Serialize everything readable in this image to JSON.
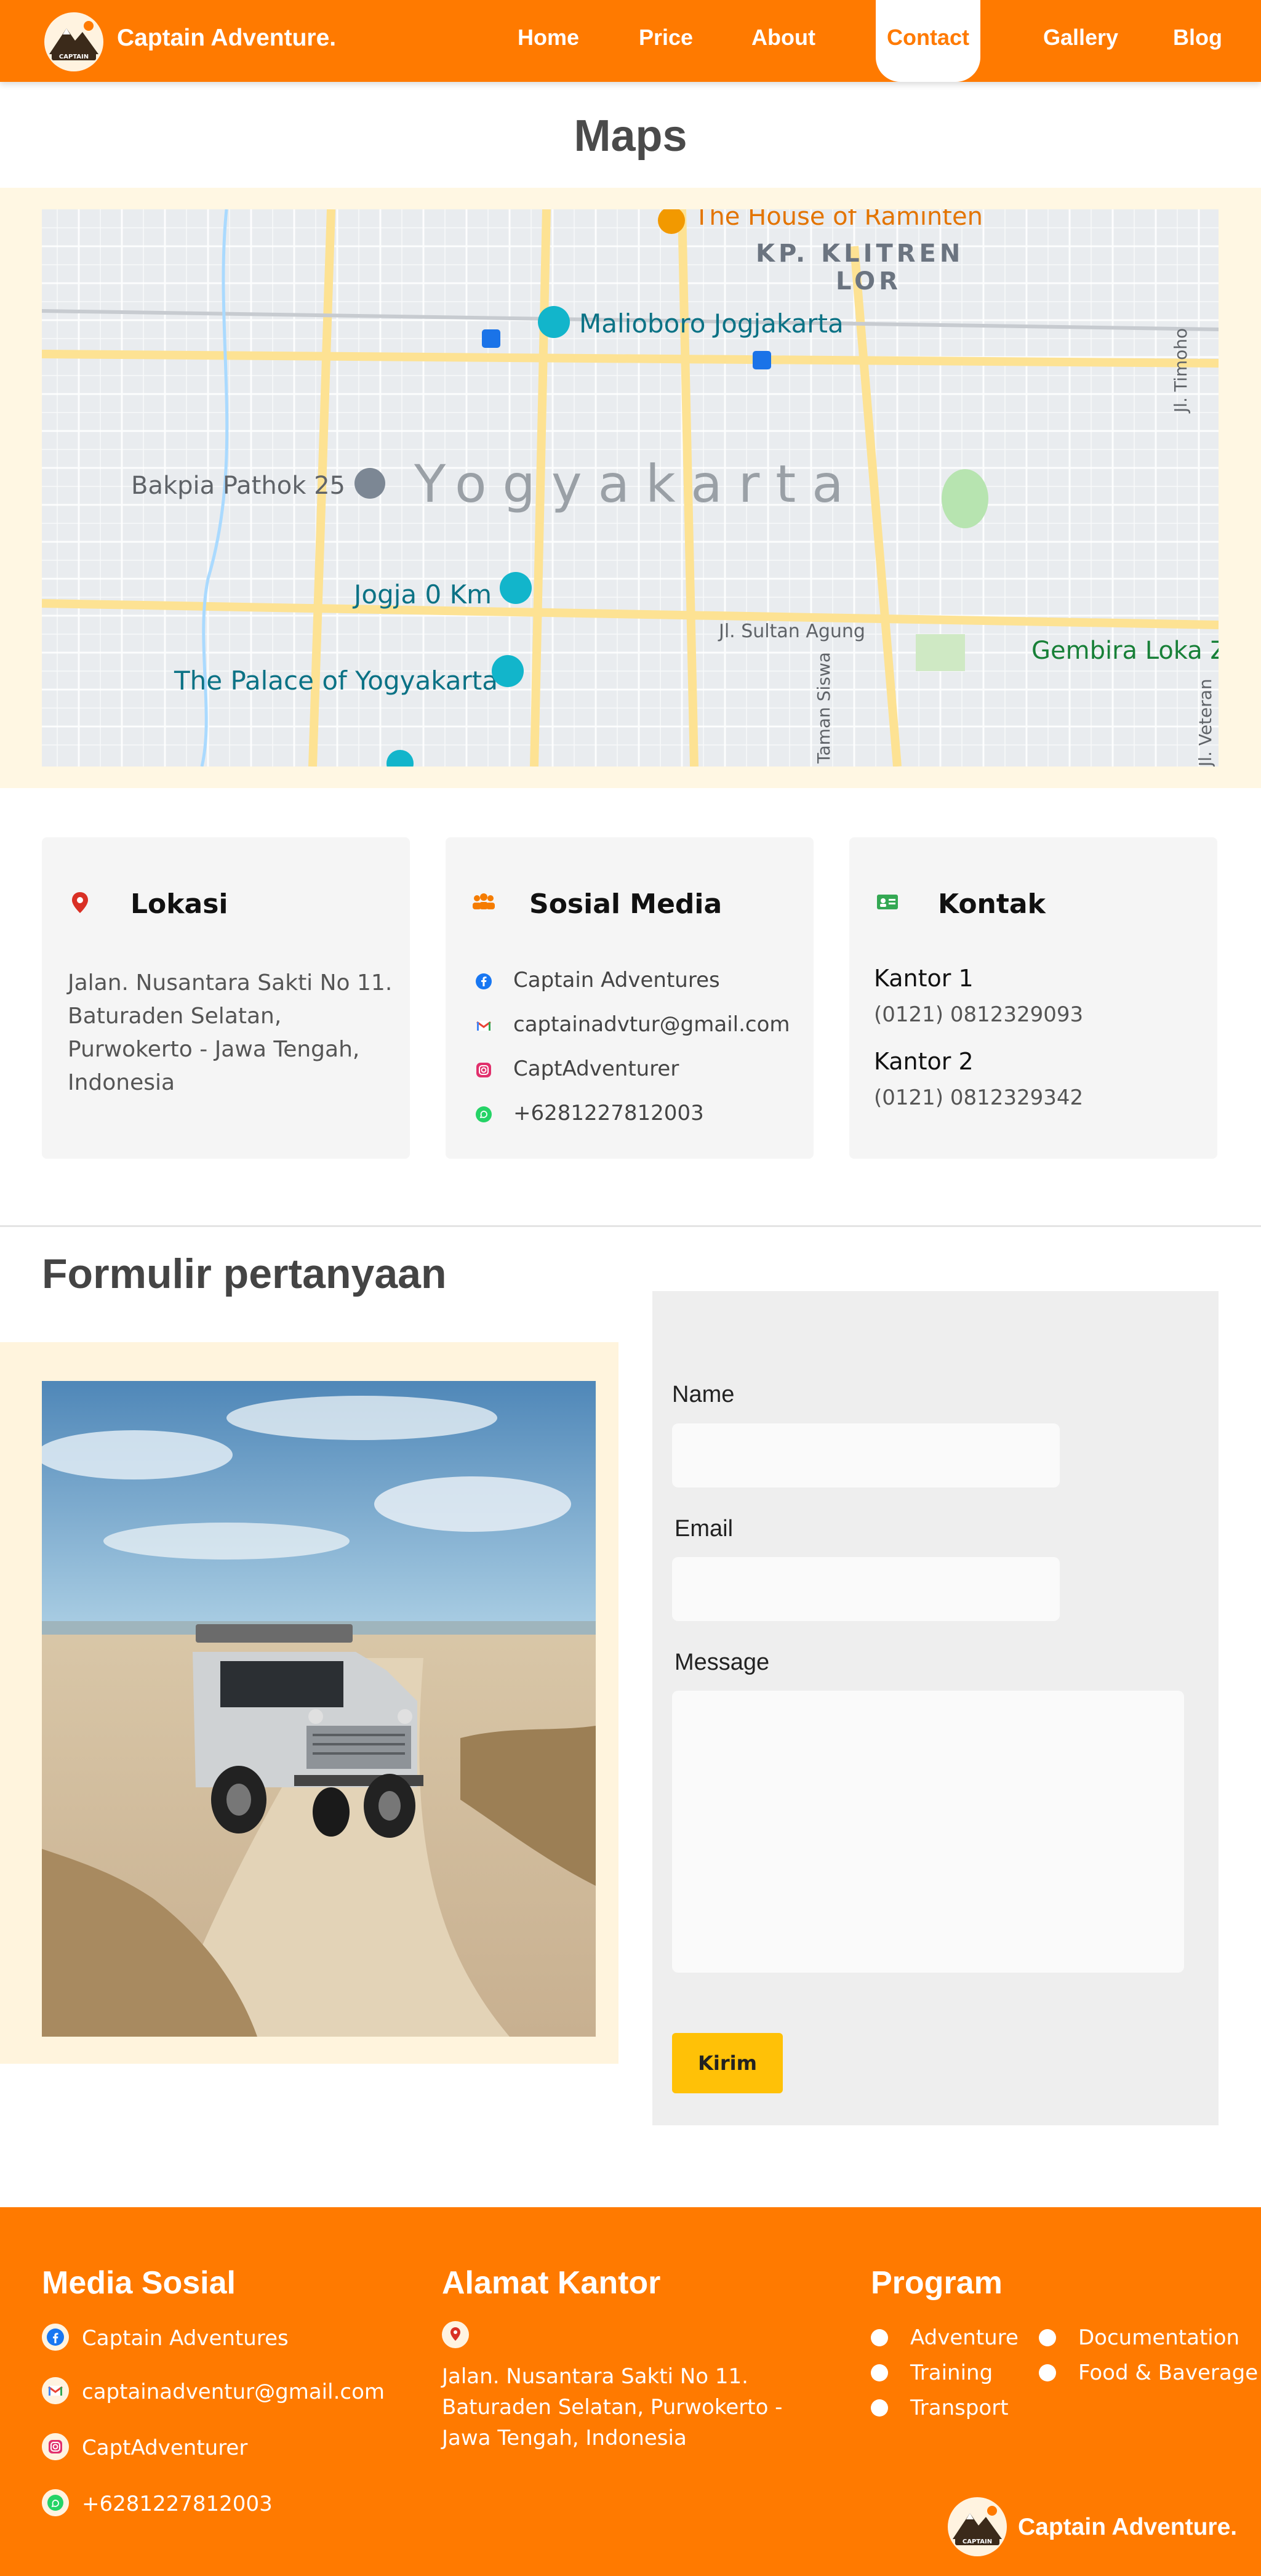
{
  "nav": {
    "brand": "Captain Adventure.",
    "logo_text": "CAPTAIN",
    "items": [
      "Home",
      "Price",
      "About",
      "Contact",
      "Gallery",
      "Blog"
    ],
    "active": "Contact"
  },
  "maps": {
    "title": "Maps",
    "labels": {
      "city": "Yogyakarta",
      "district": "KP. KLITREN",
      "district2": "LOR",
      "raminten": "The House of Raminten",
      "malioboro": "Malioboro Jogjakarta",
      "bakpia": "Bakpia Pathok 25",
      "jogja0": "Jogja 0 Km",
      "palace": "The Palace of Yogyakarta",
      "sultan": "Jl. Sultan Agung",
      "gembira": "Gembira Loka Z",
      "timoho": "Jl. Timoho",
      "taman": "Taman Siswa",
      "veteran": "Jl. Veteran"
    }
  },
  "cards": {
    "lokasi": {
      "title": "Lokasi",
      "icon": "location-pin-icon",
      "address": "Jalan. Nusantara Sakti No 11. Baturaden Selatan, Purwokerto - Jawa Tengah, Indonesia"
    },
    "sosial": {
      "title": "Sosial Media",
      "icon": "group-icon",
      "items": [
        {
          "icon": "facebook-icon",
          "text": "Captain Adventures"
        },
        {
          "icon": "gmail-icon",
          "text": "captainadvtur@gmail.com"
        },
        {
          "icon": "instagram-icon",
          "text": "CaptAdventurer"
        },
        {
          "icon": "whatsapp-icon",
          "text": "+6281227812003"
        }
      ]
    },
    "kontak": {
      "title": "Kontak",
      "icon": "contact-card-icon",
      "offices": [
        {
          "label": "Kantor 1",
          "phone": "(0121) 0812329093"
        },
        {
          "label": "Kantor 2",
          "phone": "(0121) 0812329342"
        }
      ]
    }
  },
  "form": {
    "title": "Formulir pertanyaan",
    "name_label": "Name",
    "email_label": "Email",
    "message_label": "Message",
    "name_value": "",
    "email_value": "",
    "message_value": "",
    "submit": "Kirim"
  },
  "footer": {
    "media_title": "Media Sosial",
    "media_items": [
      {
        "icon": "facebook-icon",
        "text": "Captain Adventures"
      },
      {
        "icon": "gmail-icon",
        "text": "captainadventur@gmail.com"
      },
      {
        "icon": "instagram-icon",
        "text": "CaptAdventurer"
      },
      {
        "icon": "whatsapp-icon",
        "text": "+6281227812003"
      }
    ],
    "alamat_title": "Alamat Kantor",
    "alamat": "Jalan. Nusantara Sakti No 11. Baturaden Selatan, Purwokerto - Jawa Tengah, Indonesia",
    "program_title": "Program",
    "programs": [
      "Adventure",
      "Documentation",
      "Training",
      "Food & Baverage",
      "Transport"
    ],
    "brand": "Captain Adventure."
  },
  "colors": {
    "primary": "#ff7a00",
    "accent": "#ffc107",
    "cream": "#fff7e3"
  }
}
